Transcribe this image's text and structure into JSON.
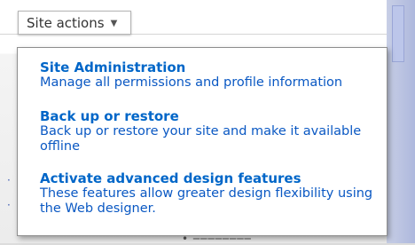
{
  "site_actions_button": {
    "label": "Site actions",
    "chevron_icon": "chevron-down-icon"
  },
  "menu": {
    "items": [
      {
        "title": "Site Administration",
        "description": "Manage all permissions and profile information"
      },
      {
        "title": "Back up or restore",
        "description": "Back up or restore your site and make it available offline"
      },
      {
        "title": "Activate advanced design features",
        "description": "These features allow greater design flexibility using the Web designer."
      }
    ]
  }
}
